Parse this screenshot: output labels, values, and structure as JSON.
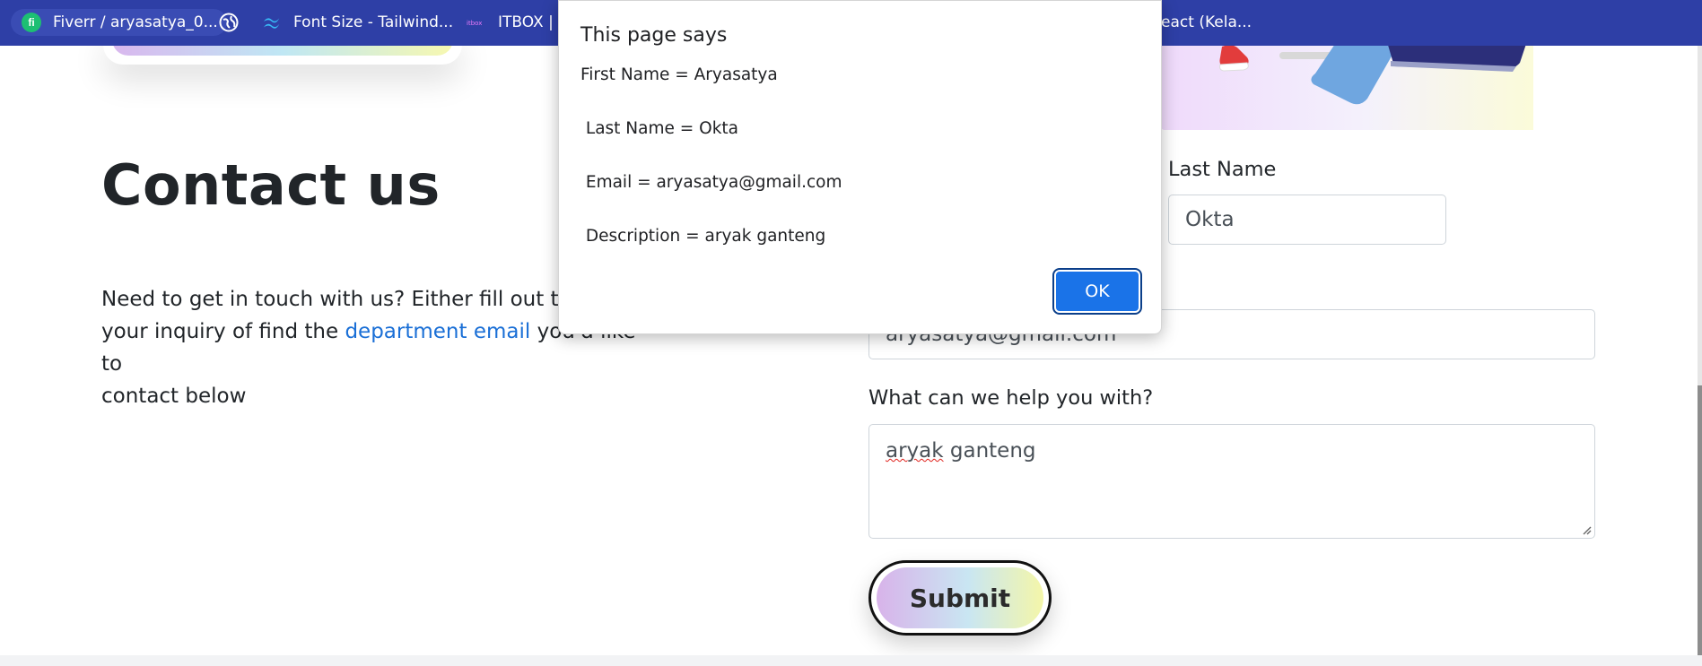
{
  "bookmarks": [
    {
      "label": "Fiverr / aryasatya_0...",
      "icon": "fiverr-icon"
    },
    {
      "label": "",
      "icon": "globe-icon"
    },
    {
      "label": "Font Size - Tailwind...",
      "icon": "tailwind-icon"
    },
    {
      "label": "ITBOX | F",
      "icon": "itbox-icon"
    },
    {
      "label": "React (Kela...",
      "icon": ""
    }
  ],
  "page": {
    "title": "Contact us",
    "intro_before": "Need to get in touch with us? Either fill out the f",
    "intro_line2_before": "your inquiry of find the ",
    "intro_link": "department email",
    "intro_after": " you'd like to",
    "intro_line3": "contact below"
  },
  "form": {
    "last_name_label": "Last Name",
    "last_name_value": "Okta",
    "email_value": "aryasatya@gmail.com",
    "help_label": "What can we help you with?",
    "help_value_misspelled": "aryak",
    "help_value_rest": " ganteng",
    "submit_label": "Submit"
  },
  "dialog": {
    "title": "This page says",
    "lines": [
      "First Name = Aryasatya",
      " Last Name = Okta",
      " Email = aryasatya@gmail.com",
      " Description = aryak ganteng"
    ],
    "ok_label": "OK"
  },
  "colors": {
    "bookmarks_bar": "#2e3fa6",
    "link": "#1a6fd6",
    "ok_button": "#1a73e8"
  }
}
